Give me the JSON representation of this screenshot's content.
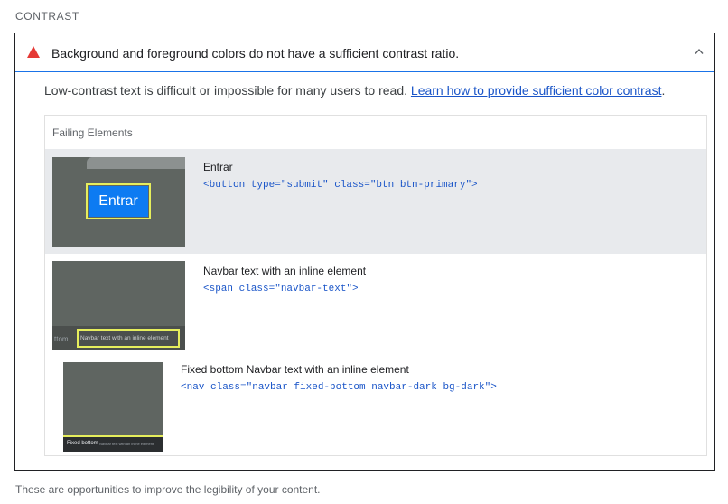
{
  "section": {
    "title": "CONTRAST"
  },
  "audit": {
    "title": "Background and foreground colors do not have a sufficient contrast ratio.",
    "description": "Low-contrast text is difficult or impossible for many users to read. ",
    "link_text": "Learn how to provide sufficient color contrast",
    "description_end": ".",
    "status_icon": "warning-triangle-icon",
    "status_color": "#e53935",
    "expand_icon": "chevron-up-icon"
  },
  "table": {
    "header": "Failing Elements",
    "rows": [
      {
        "label": "Entrar",
        "snippet": "<button type=\"submit\" class=\"btn btn-primary\">",
        "thumb_text": "Entrar"
      },
      {
        "label": "Navbar text with an inline element",
        "snippet": "<span class=\"navbar-text\">",
        "thumb_left_text": "ttom",
        "thumb_text": "Navbar text with an inline element"
      },
      {
        "label": "Fixed bottom Navbar text with an inline element",
        "snippet": "<nav class=\"navbar fixed-bottom navbar-dark bg-dark\">",
        "thumb_text": "Fixed bottom",
        "thumb_sub_text": "Navbar text with an inline element"
      }
    ]
  },
  "footer": {
    "note": "These are opportunities to improve the legibility of your content."
  },
  "colors": {
    "highlight_border": "#e6ee5c",
    "button_blue": "#0d7bf2",
    "thumb_gray": "#5f6561",
    "selected_row": "#e8eaed"
  }
}
